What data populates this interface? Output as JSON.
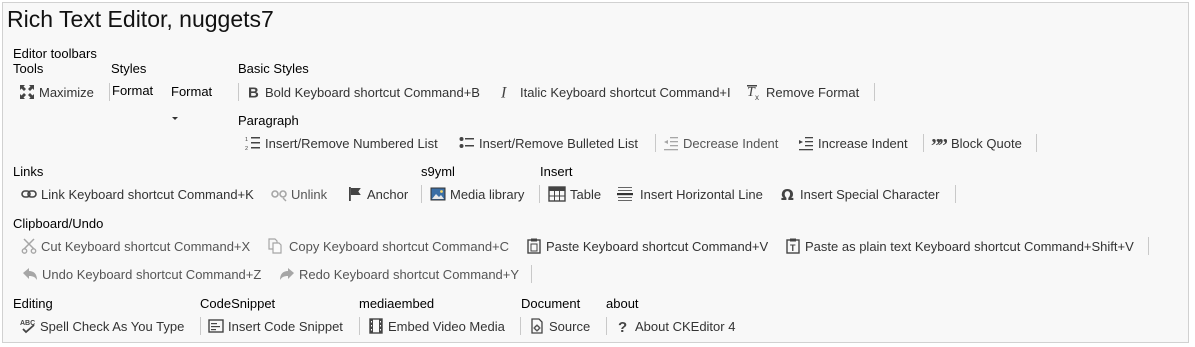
{
  "editor": {
    "title": "Rich Text Editor, nuggets7",
    "toolbars_label": "Editor toolbars"
  },
  "groups": {
    "tools": "Tools",
    "styles": "Styles",
    "basic_styles": "Basic Styles",
    "paragraph": "Paragraph",
    "links": "Links",
    "s9yml": "s9yml",
    "insert": "Insert",
    "clipboard": "Clipboard/Undo",
    "editing": "Editing",
    "codesnippet": "CodeSnippet",
    "mediaembed": "mediaembed",
    "document": "Document",
    "about": "about"
  },
  "buttons": {
    "maximize": "Maximize",
    "format_label": "Format",
    "format_combo": "Format",
    "bold": "Bold Keyboard shortcut Command+B",
    "italic": "Italic Keyboard shortcut Command+I",
    "remove_format": "Remove Format",
    "numbered_list": "Insert/Remove Numbered List",
    "bulleted_list": "Insert/Remove Bulleted List",
    "decrease_indent": "Decrease Indent",
    "increase_indent": "Increase Indent",
    "block_quote": "Block Quote",
    "link": "Link Keyboard shortcut Command+K",
    "unlink": "Unlink",
    "anchor": "Anchor",
    "media_library": "Media library",
    "table": "Table",
    "horizontal_line": "Insert Horizontal Line",
    "special_char": "Insert Special Character",
    "cut": "Cut Keyboard shortcut Command+X",
    "copy": "Copy Keyboard shortcut Command+C",
    "paste": "Paste Keyboard shortcut Command+V",
    "paste_plain": "Paste as plain text Keyboard shortcut Command+Shift+V",
    "undo": "Undo Keyboard shortcut Command+Z",
    "redo": "Redo Keyboard shortcut Command+Y",
    "spell_check": "Spell Check As You Type",
    "code_snippet": "Insert Code Snippet",
    "embed_video": "Embed Video Media",
    "source": "Source",
    "about_ck": "About CKEditor 4"
  }
}
